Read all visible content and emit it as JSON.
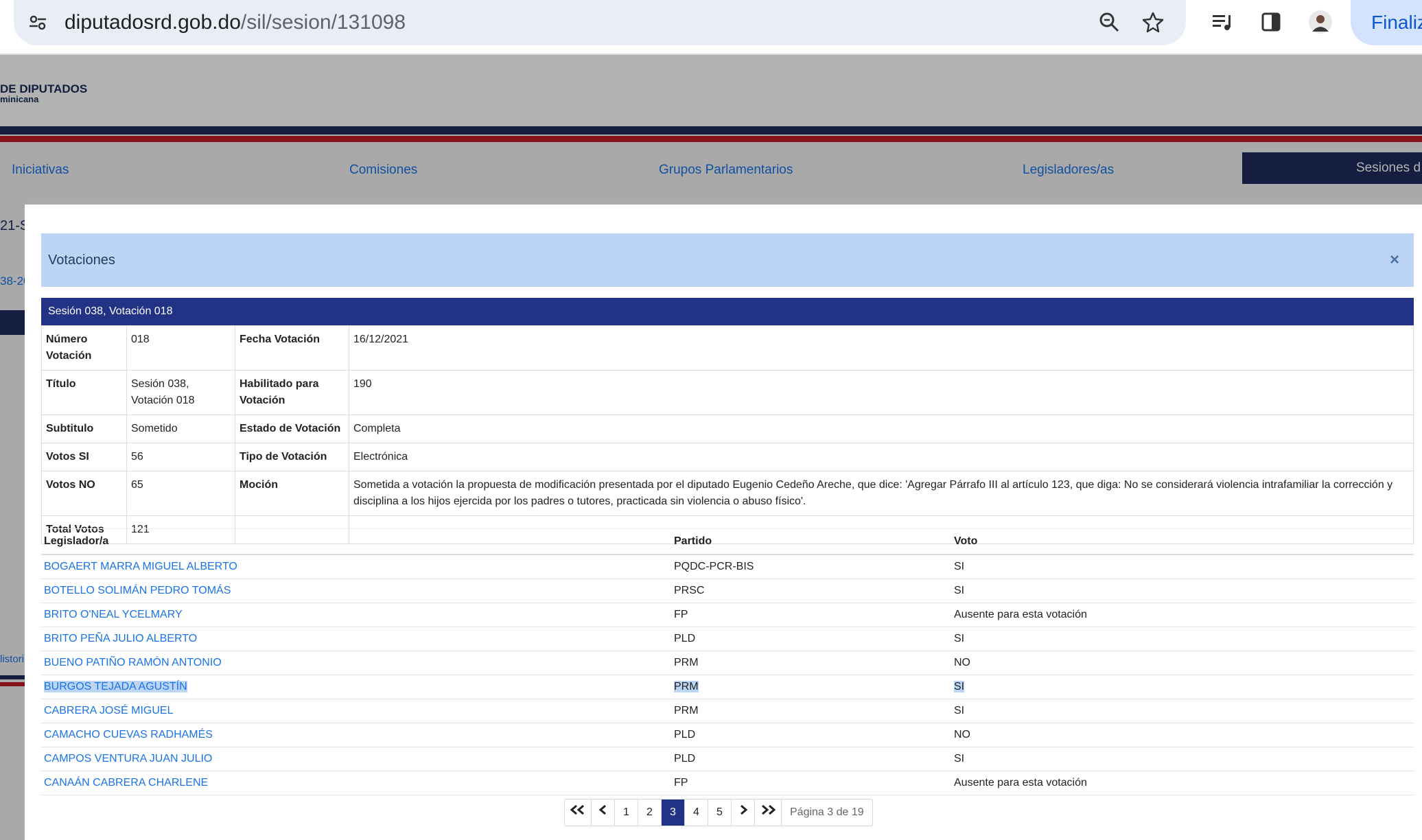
{
  "browser": {
    "url_host": "diputadosrd.gob.do",
    "url_path": "/sil/sesion/131098",
    "finaliz_label": "Finaliz"
  },
  "site": {
    "logo_title": "DE DIPUTADOS",
    "logo_sub": "minicana",
    "nav": [
      "Iniciativas",
      "Comisiones",
      "Grupos Parlamentarios",
      "Legisladores/as",
      "Sesiones d"
    ],
    "left_fragments": [
      "21-S",
      "38-20",
      "listori"
    ]
  },
  "modal": {
    "title": "Votaciones",
    "close": "×",
    "session_header": "Sesión 038, Votación 018",
    "info": {
      "numero_label": "Número Votación",
      "numero": "018",
      "fecha_label": "Fecha Votación",
      "fecha": "16/12/2021",
      "titulo_label": "Título",
      "titulo": "Sesión 038, Votación 018",
      "habilitado_label": "Habilitado para Votación",
      "habilitado": "190",
      "subtitulo_label": "Subtitulo",
      "subtitulo": "Sometido",
      "estado_label": "Estado de Votación",
      "estado": "Completa",
      "votos_si_label": "Votos SI",
      "votos_si": "56",
      "tipo_label": "Tipo de Votación",
      "tipo": "Electrónica",
      "votos_no_label": "Votos NO",
      "votos_no": "65",
      "mocion_label": "Moción",
      "mocion": "Sometida a votación la propuesta de modificación presentada por el diputado Eugenio Cedeño Areche, que dice: 'Agregar Párrafo III al artículo 123, que diga: No se considerará violencia intrafamiliar la corrección y disciplina a los hijos ejercida por los padres o tutores, practicada sin violencia o abuso físico'.",
      "total_label": "Total Votos",
      "total": "121"
    },
    "votes_headers": {
      "legislador": "Legislador/a",
      "partido": "Partido",
      "voto": "Voto"
    },
    "votes": [
      {
        "name": "BOGAERT MARRA MIGUEL ALBERTO",
        "party": "PQDC-PCR-BIS",
        "vote": "SI"
      },
      {
        "name": "BOTELLO SOLIMÁN PEDRO TOMÁS",
        "party": "PRSC",
        "vote": "SI"
      },
      {
        "name": "BRITO O'NEAL YCELMARY",
        "party": "FP",
        "vote": "Ausente para esta votación"
      },
      {
        "name": "BRITO PEÑA JULIO ALBERTO",
        "party": "PLD",
        "vote": "SI"
      },
      {
        "name": "BUENO PATIÑO RAMÓN ANTONIO",
        "party": "PRM",
        "vote": "NO"
      },
      {
        "name": "BURGOS TEJADA AGUSTÍN",
        "party": "PRM",
        "vote": "SI"
      },
      {
        "name": "CABRERA JOSÉ MIGUEL",
        "party": "PRM",
        "vote": "SI"
      },
      {
        "name": "CAMACHO CUEVAS RADHAMÉS",
        "party": "PLD",
        "vote": "NO"
      },
      {
        "name": "CAMPOS VENTURA JUAN JULIO",
        "party": "PLD",
        "vote": "SI"
      },
      {
        "name": "CANAÁN CABRERA CHARLENE",
        "party": "FP",
        "vote": "Ausente para esta votación"
      }
    ],
    "pager": {
      "first": "«",
      "prev": "‹",
      "pages": [
        "1",
        "2",
        "3",
        "4",
        "5"
      ],
      "current": "3",
      "next": "›",
      "last": "»",
      "info": "Página 3 de 19"
    }
  },
  "colors": {
    "accent": "#223385",
    "link": "#1a73e8",
    "modal_header": "#bcd5f4",
    "stripe_red": "#c01b2b"
  }
}
